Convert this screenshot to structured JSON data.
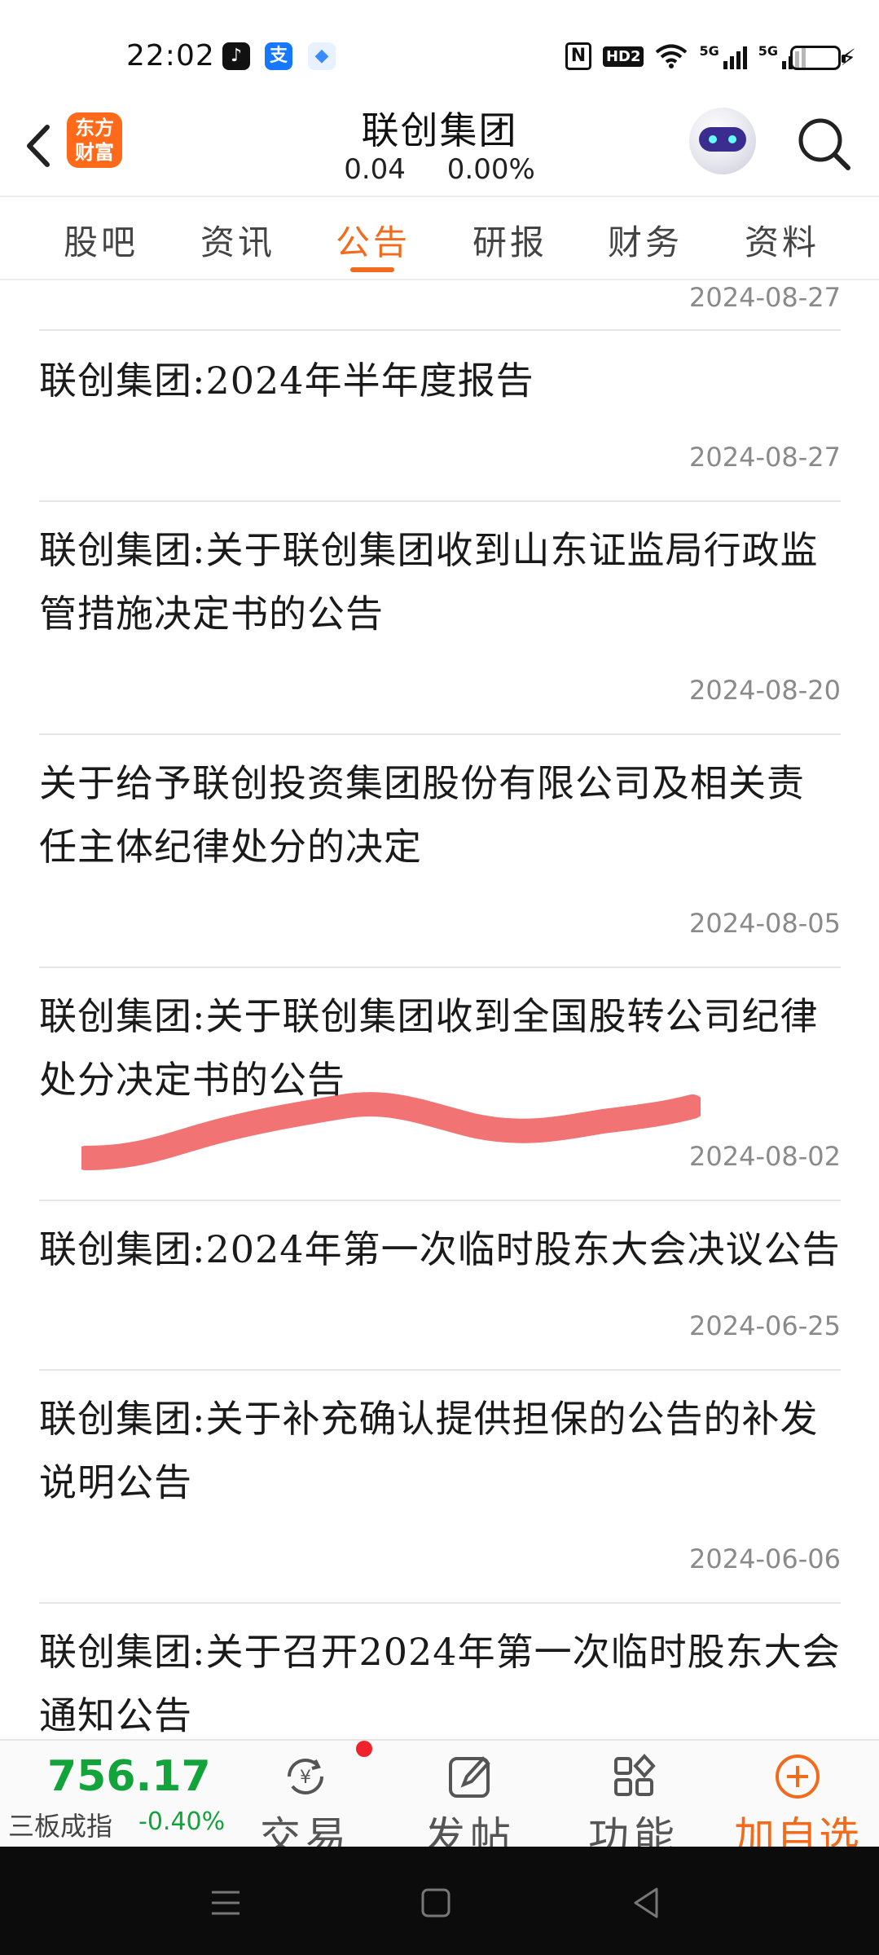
{
  "status_bar": {
    "time": "22:02",
    "network_1": "5G",
    "network_2": "5G",
    "hd_label": "HD2",
    "nfc_label": "N"
  },
  "header": {
    "logo_text": "东方财富",
    "title": "联创集团",
    "price": "0.04",
    "change_pct": "0.00%"
  },
  "tabs": [
    {
      "label": "股吧",
      "active": false
    },
    {
      "label": "资讯",
      "active": false
    },
    {
      "label": "公告",
      "active": true
    },
    {
      "label": "研报",
      "active": false
    },
    {
      "label": "财务",
      "active": false
    },
    {
      "label": "资料",
      "active": false
    }
  ],
  "announcements": [
    {
      "title": "",
      "date": "2024-08-27"
    },
    {
      "title": "联创集团:2024年半年度报告",
      "date": "2024-08-27"
    },
    {
      "title": "联创集团:关于联创集团收到山东证监局行政监管措施决定书的公告",
      "date": "2024-08-20"
    },
    {
      "title": "关于给予联创投资集团股份有限公司及相关责任主体纪律处分的决定",
      "date": "2024-08-05"
    },
    {
      "title": "联创集团:关于联创集团收到全国股转公司纪律处分决定书的公告",
      "date": "2024-08-02"
    },
    {
      "title": "联创集团:2024年第一次临时股东大会决议公告",
      "date": "2024-06-25"
    },
    {
      "title": "联创集团:关于补充确认提供担保的公告的补发说明公告",
      "date": "2024-06-06"
    },
    {
      "title": "联创集团:关于召开2024年第一次临时股东大会通知公告",
      "date": ""
    }
  ],
  "bottom_bar": {
    "index_value": "756.17",
    "index_name": "三板成指",
    "index_change": "-0.40%",
    "items": [
      {
        "label": "交易",
        "icon": "yen-cycle-icon"
      },
      {
        "label": "发帖",
        "icon": "edit-icon"
      },
      {
        "label": "功能",
        "icon": "grid-icon"
      },
      {
        "label": "加自选",
        "icon": "plus-circle-icon"
      }
    ]
  },
  "colors": {
    "accent": "#f26b1d",
    "up_green": "#12a33a",
    "date_gray": "#8a8a8a",
    "scribble": "#ee5a5a"
  }
}
